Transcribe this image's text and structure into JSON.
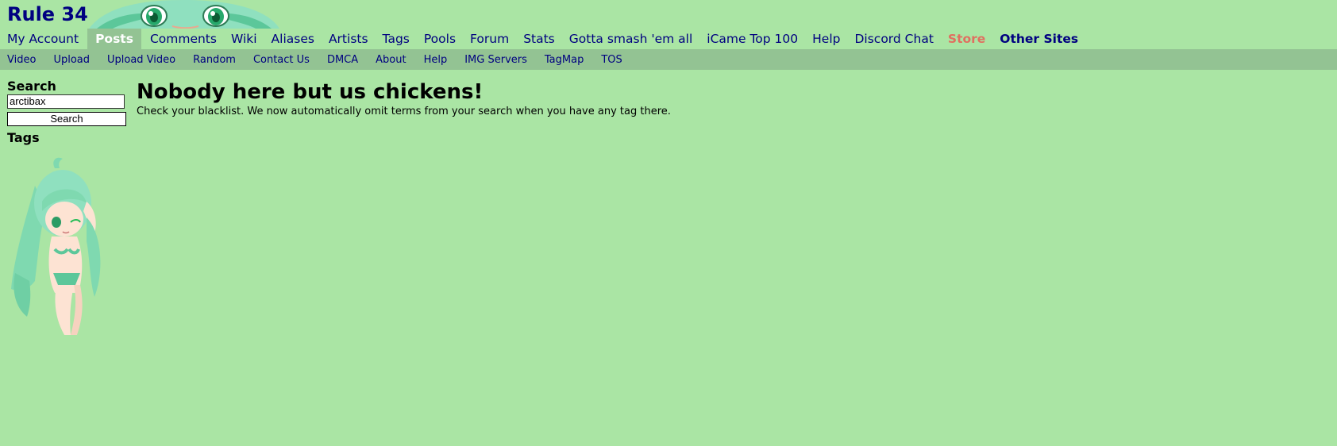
{
  "header": {
    "site_title": "Rule 34"
  },
  "nav": {
    "items": [
      {
        "label": "My Account"
      },
      {
        "label": "Posts",
        "current": true
      },
      {
        "label": "Comments"
      },
      {
        "label": "Wiki"
      },
      {
        "label": "Aliases"
      },
      {
        "label": "Artists"
      },
      {
        "label": "Tags"
      },
      {
        "label": "Pools"
      },
      {
        "label": "Forum"
      },
      {
        "label": "Stats"
      },
      {
        "label": "Gotta smash 'em all"
      },
      {
        "label": "iCame Top 100"
      },
      {
        "label": "Help"
      },
      {
        "label": "Discord Chat"
      },
      {
        "label": "Store",
        "color": "#e07060"
      },
      {
        "label": "Other Sites"
      }
    ]
  },
  "subnav": {
    "items": [
      {
        "label": "Video"
      },
      {
        "label": "Upload"
      },
      {
        "label": "Upload Video"
      },
      {
        "label": "Random"
      },
      {
        "label": "Contact Us"
      },
      {
        "label": "DMCA"
      },
      {
        "label": "About"
      },
      {
        "label": "Help"
      },
      {
        "label": "IMG Servers"
      },
      {
        "label": "TagMap"
      },
      {
        "label": "TOS"
      }
    ]
  },
  "sidebar": {
    "search_heading": "Search",
    "search_value": "arctibax",
    "search_button": "Search",
    "tags_heading": "Tags"
  },
  "main": {
    "title": "Nobody here but us chickens!",
    "message": "Check your blacklist. We now automatically omit terms from your search when you have any tag there."
  },
  "colors": {
    "background": "#aae5a4",
    "subnav_background": "#93c393",
    "link": "#000080",
    "store": "#e07060"
  }
}
